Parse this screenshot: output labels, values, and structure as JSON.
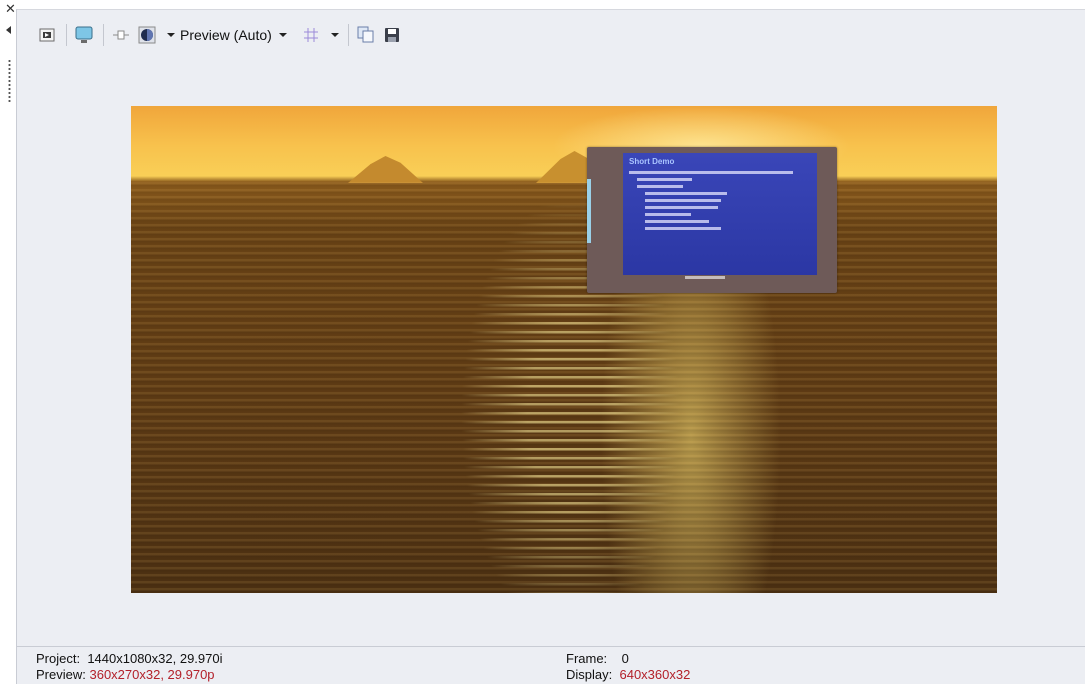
{
  "toolbar": {
    "preview_quality_label": "Preview (Auto)",
    "icons": [
      "close-icon",
      "collapse-arrow-icon",
      "video-properties-icon",
      "external-monitor-icon",
      "split-screen-icon",
      "preview-quality-icon",
      "overlays-grid-icon",
      "copy-snapshot-icon",
      "save-snapshot-icon"
    ]
  },
  "video_frame": {
    "description_colors": {
      "sky": "#f8c24d",
      "water": "#5d3a14",
      "slide": "#3a46b8"
    },
    "slide": {
      "title": "Short Demo"
    }
  },
  "status": {
    "project_label": "Project:",
    "project_value": "1440x1080x32, 29.970i",
    "preview_label": "Preview:",
    "preview_value": "360x270x32, 29.970p",
    "frame_label": "Frame:",
    "frame_value": "0",
    "display_label": "Display:",
    "display_value": "640x360x32"
  },
  "colors": {
    "panel_bg": "#eceef3",
    "status_highlight": "#b3202a"
  }
}
